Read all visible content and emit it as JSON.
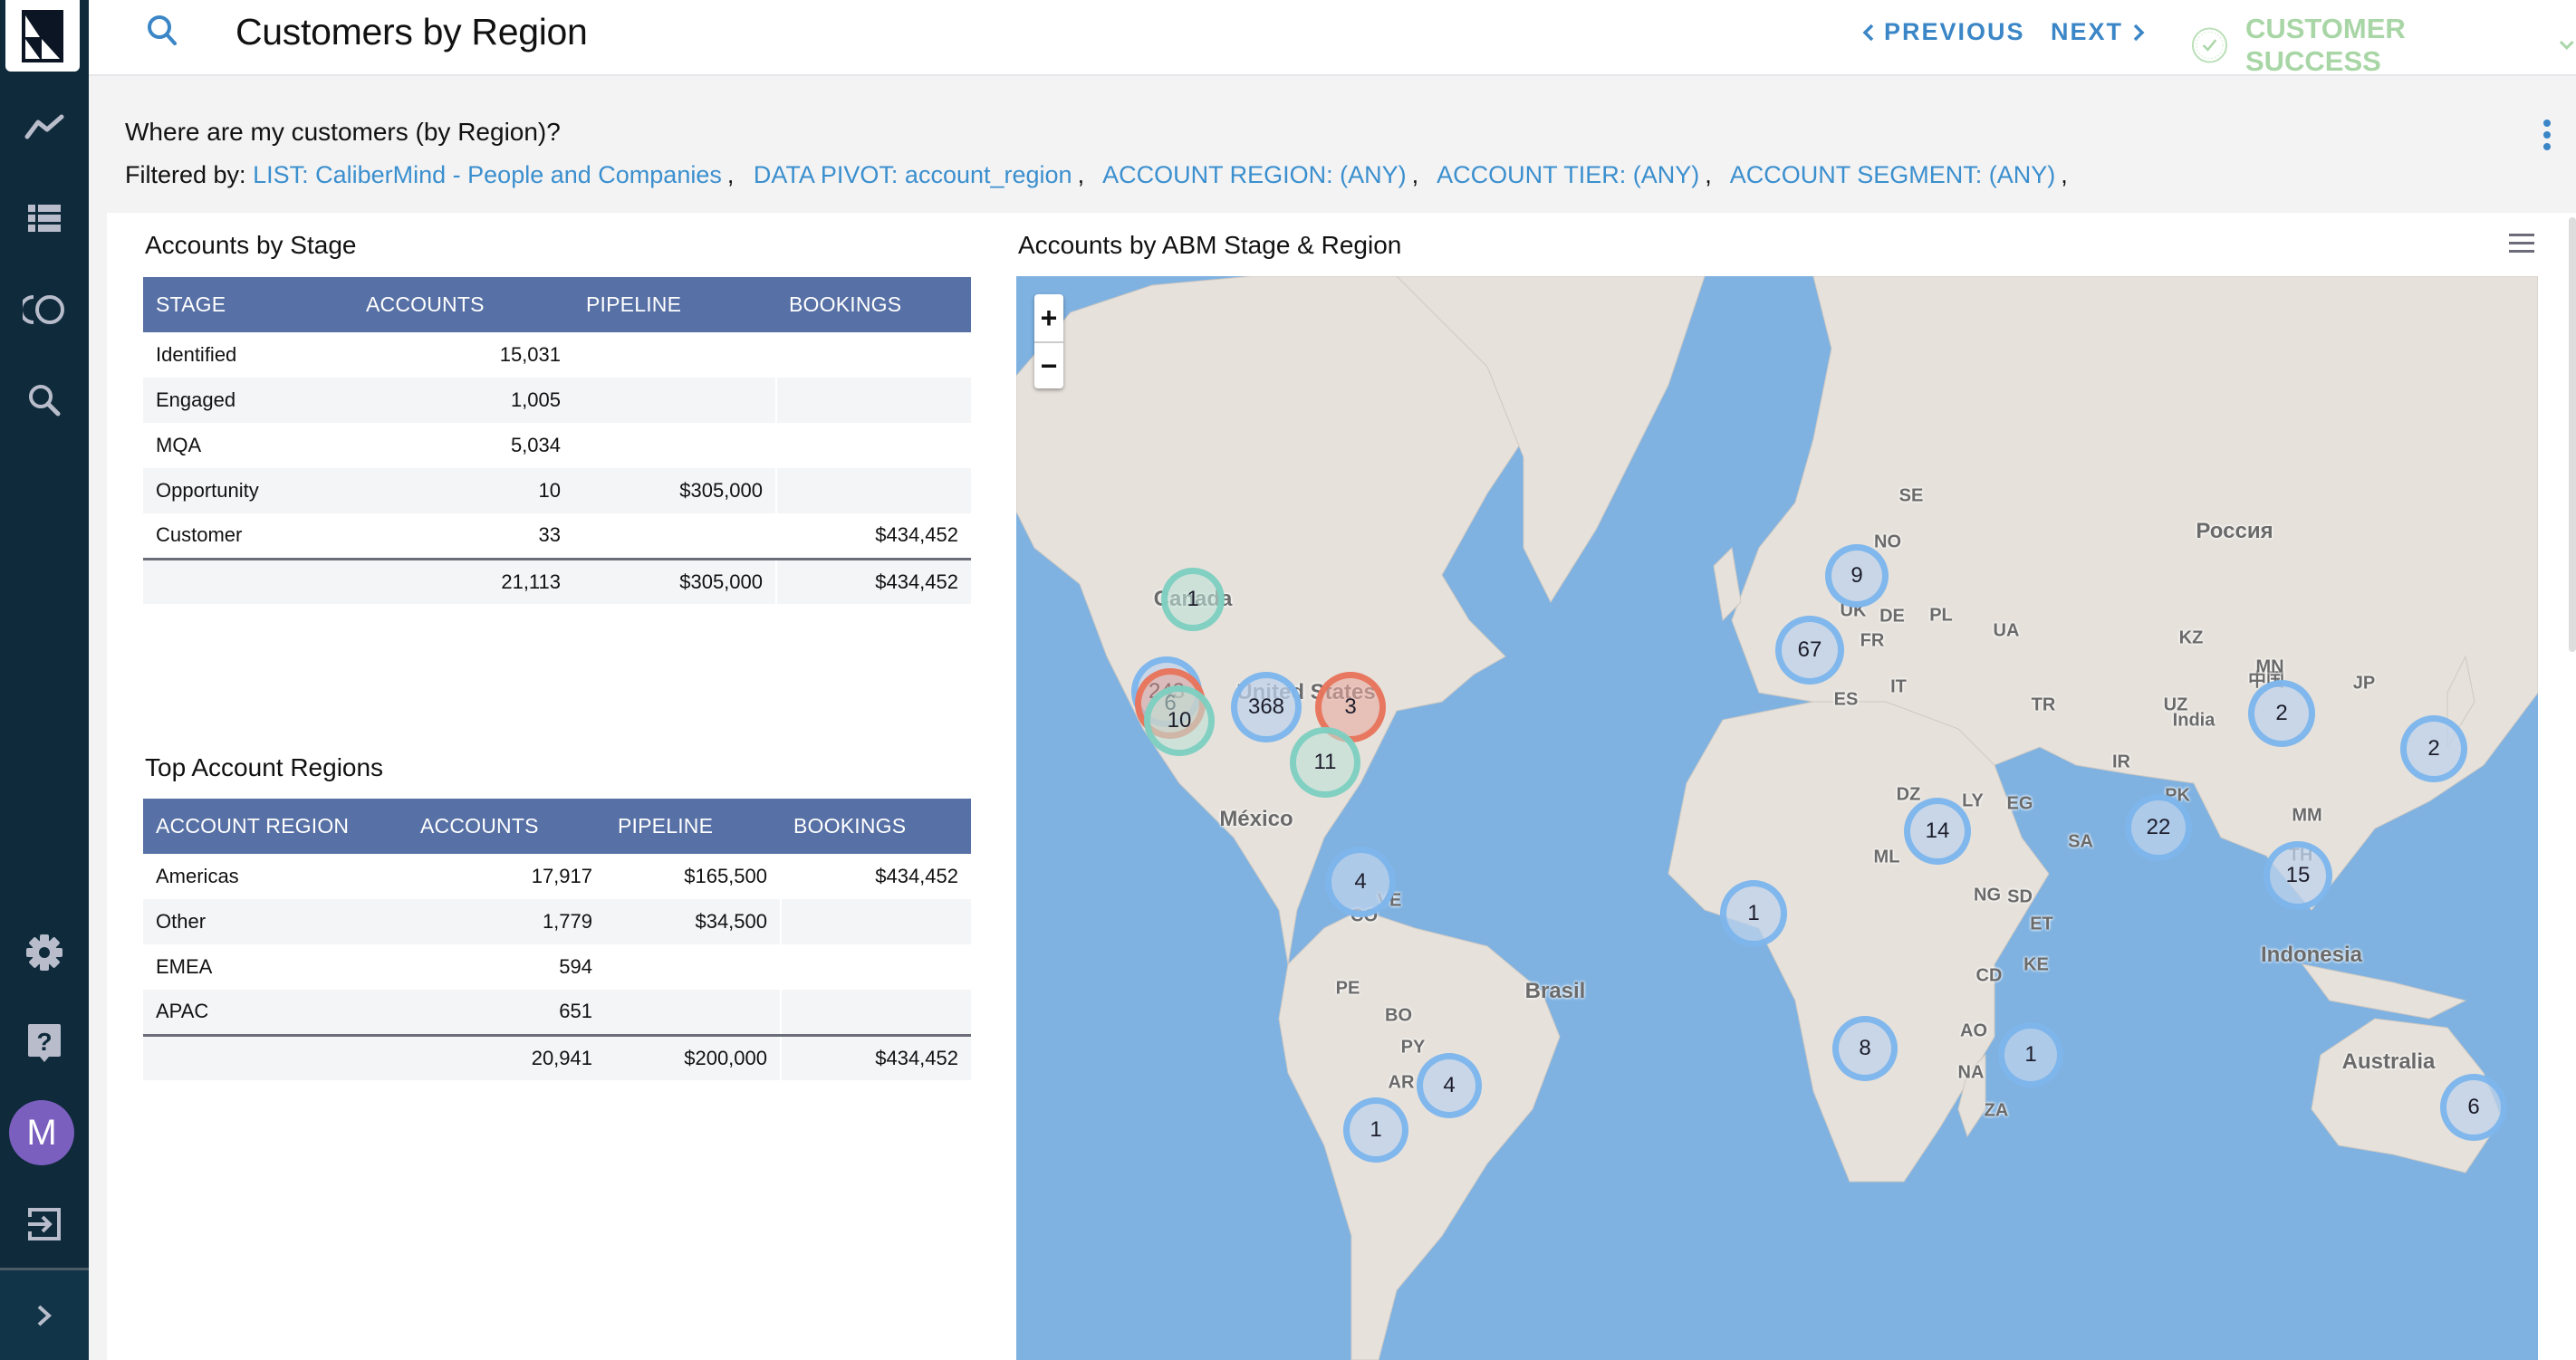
{
  "header": {
    "title": "Customers by Region",
    "previous_label": "PREVIOUS",
    "next_label": "NEXT",
    "category_label": "CUSTOMER SUCCESS"
  },
  "question": "Where are my customers (by Region)?",
  "filters": {
    "prefix": "Filtered by:",
    "items": [
      "LIST: CaliberMind - People and Companies",
      "DATA PIVOT: account_region",
      "ACCOUNT REGION: (ANY)",
      "ACCOUNT TIER: (ANY)",
      "ACCOUNT SEGMENT: (ANY)"
    ]
  },
  "sidebar": {
    "avatar_initial": "M",
    "items": [
      "trends-icon",
      "list-icon",
      "journey-icon",
      "search-icon",
      "settings-icon",
      "help-icon",
      "logout-icon",
      "expand-icon"
    ]
  },
  "accounts_by_stage": {
    "title": "Accounts by Stage",
    "columns": [
      "STAGE",
      "ACCOUNTS",
      "PIPELINE",
      "BOOKINGS"
    ],
    "rows": [
      [
        "Identified",
        "15,031",
        "",
        ""
      ],
      [
        "Engaged",
        "1,005",
        "",
        ""
      ],
      [
        "MQA",
        "5,034",
        "",
        ""
      ],
      [
        "Opportunity",
        "10",
        "$305,000",
        ""
      ],
      [
        "Customer",
        "33",
        "",
        "$434,452"
      ]
    ],
    "totals": [
      "",
      "21,113",
      "$305,000",
      "$434,452"
    ]
  },
  "top_regions": {
    "title": "Top Account Regions",
    "columns": [
      "ACCOUNT REGION",
      "ACCOUNTS",
      "PIPELINE",
      "BOOKINGS"
    ],
    "rows": [
      [
        "Americas",
        "17,917",
        "$165,500",
        "$434,452"
      ],
      [
        "Other",
        "1,779",
        "$34,500",
        ""
      ],
      [
        "EMEA",
        "594",
        "",
        ""
      ],
      [
        "APAC",
        "651",
        "",
        ""
      ]
    ],
    "totals": [
      "",
      "20,941",
      "$200,000",
      "$434,452"
    ]
  },
  "map": {
    "title": "Accounts by ABM Stage & Region",
    "zoom_in": "+",
    "zoom_out": "−",
    "colors": {
      "ocean": "#7fb2e1",
      "land": "#e6e1db",
      "blue": "#7cb5ec",
      "red": "#e8735a",
      "green": "#7ccfc0"
    },
    "labels": [
      "Canada",
      "United States",
      "México",
      "Brasil",
      "Россия",
      "Indonesia",
      "Australia",
      "中国",
      "India",
      "SE",
      "NO",
      "UK",
      "FR",
      "ES",
      "IT",
      "DE",
      "PL",
      "UA",
      "TR",
      "KZ",
      "UZ",
      "IR",
      "PK",
      "MN",
      "MM",
      "TH",
      "JP",
      "DZ",
      "LY",
      "EG",
      "ML",
      "NG",
      "SD",
      "ET",
      "KE",
      "CD",
      "AO",
      "NA",
      "ZA",
      "SA",
      "VE",
      "CO",
      "PE",
      "BO",
      "PY",
      "AR"
    ],
    "clusters": [
      {
        "count": "1",
        "color": "green",
        "region": "Canada"
      },
      {
        "count": "243",
        "color": "blue",
        "region": "US West"
      },
      {
        "count": "6",
        "color": "red",
        "region": "US West"
      },
      {
        "count": "10",
        "color": "green",
        "region": "US Southwest"
      },
      {
        "count": "368",
        "color": "blue",
        "region": "US Central"
      },
      {
        "count": "3",
        "color": "red",
        "region": "US Northeast"
      },
      {
        "count": "11",
        "color": "green",
        "region": "US Southeast"
      },
      {
        "count": "4",
        "color": "blue",
        "region": "Caribbean"
      },
      {
        "count": "4",
        "color": "blue",
        "region": "Brazil South"
      },
      {
        "count": "1",
        "color": "blue",
        "region": "Chile/Argentina"
      },
      {
        "count": "9",
        "color": "blue",
        "region": "Baltics"
      },
      {
        "count": "67",
        "color": "blue",
        "region": "Central Europe"
      },
      {
        "count": "14",
        "color": "blue",
        "region": "Red Sea"
      },
      {
        "count": "1",
        "color": "blue",
        "region": "West Africa"
      },
      {
        "count": "8",
        "color": "blue",
        "region": "Southern Africa"
      },
      {
        "count": "1",
        "color": "blue",
        "region": "Indian Ocean"
      },
      {
        "count": "22",
        "color": "blue",
        "region": "India"
      },
      {
        "count": "2",
        "color": "blue",
        "region": "China"
      },
      {
        "count": "2",
        "color": "blue",
        "region": "Japan"
      },
      {
        "count": "15",
        "color": "blue",
        "region": "Southeast Asia"
      },
      {
        "count": "6",
        "color": "blue",
        "region": "Australia"
      }
    ]
  }
}
